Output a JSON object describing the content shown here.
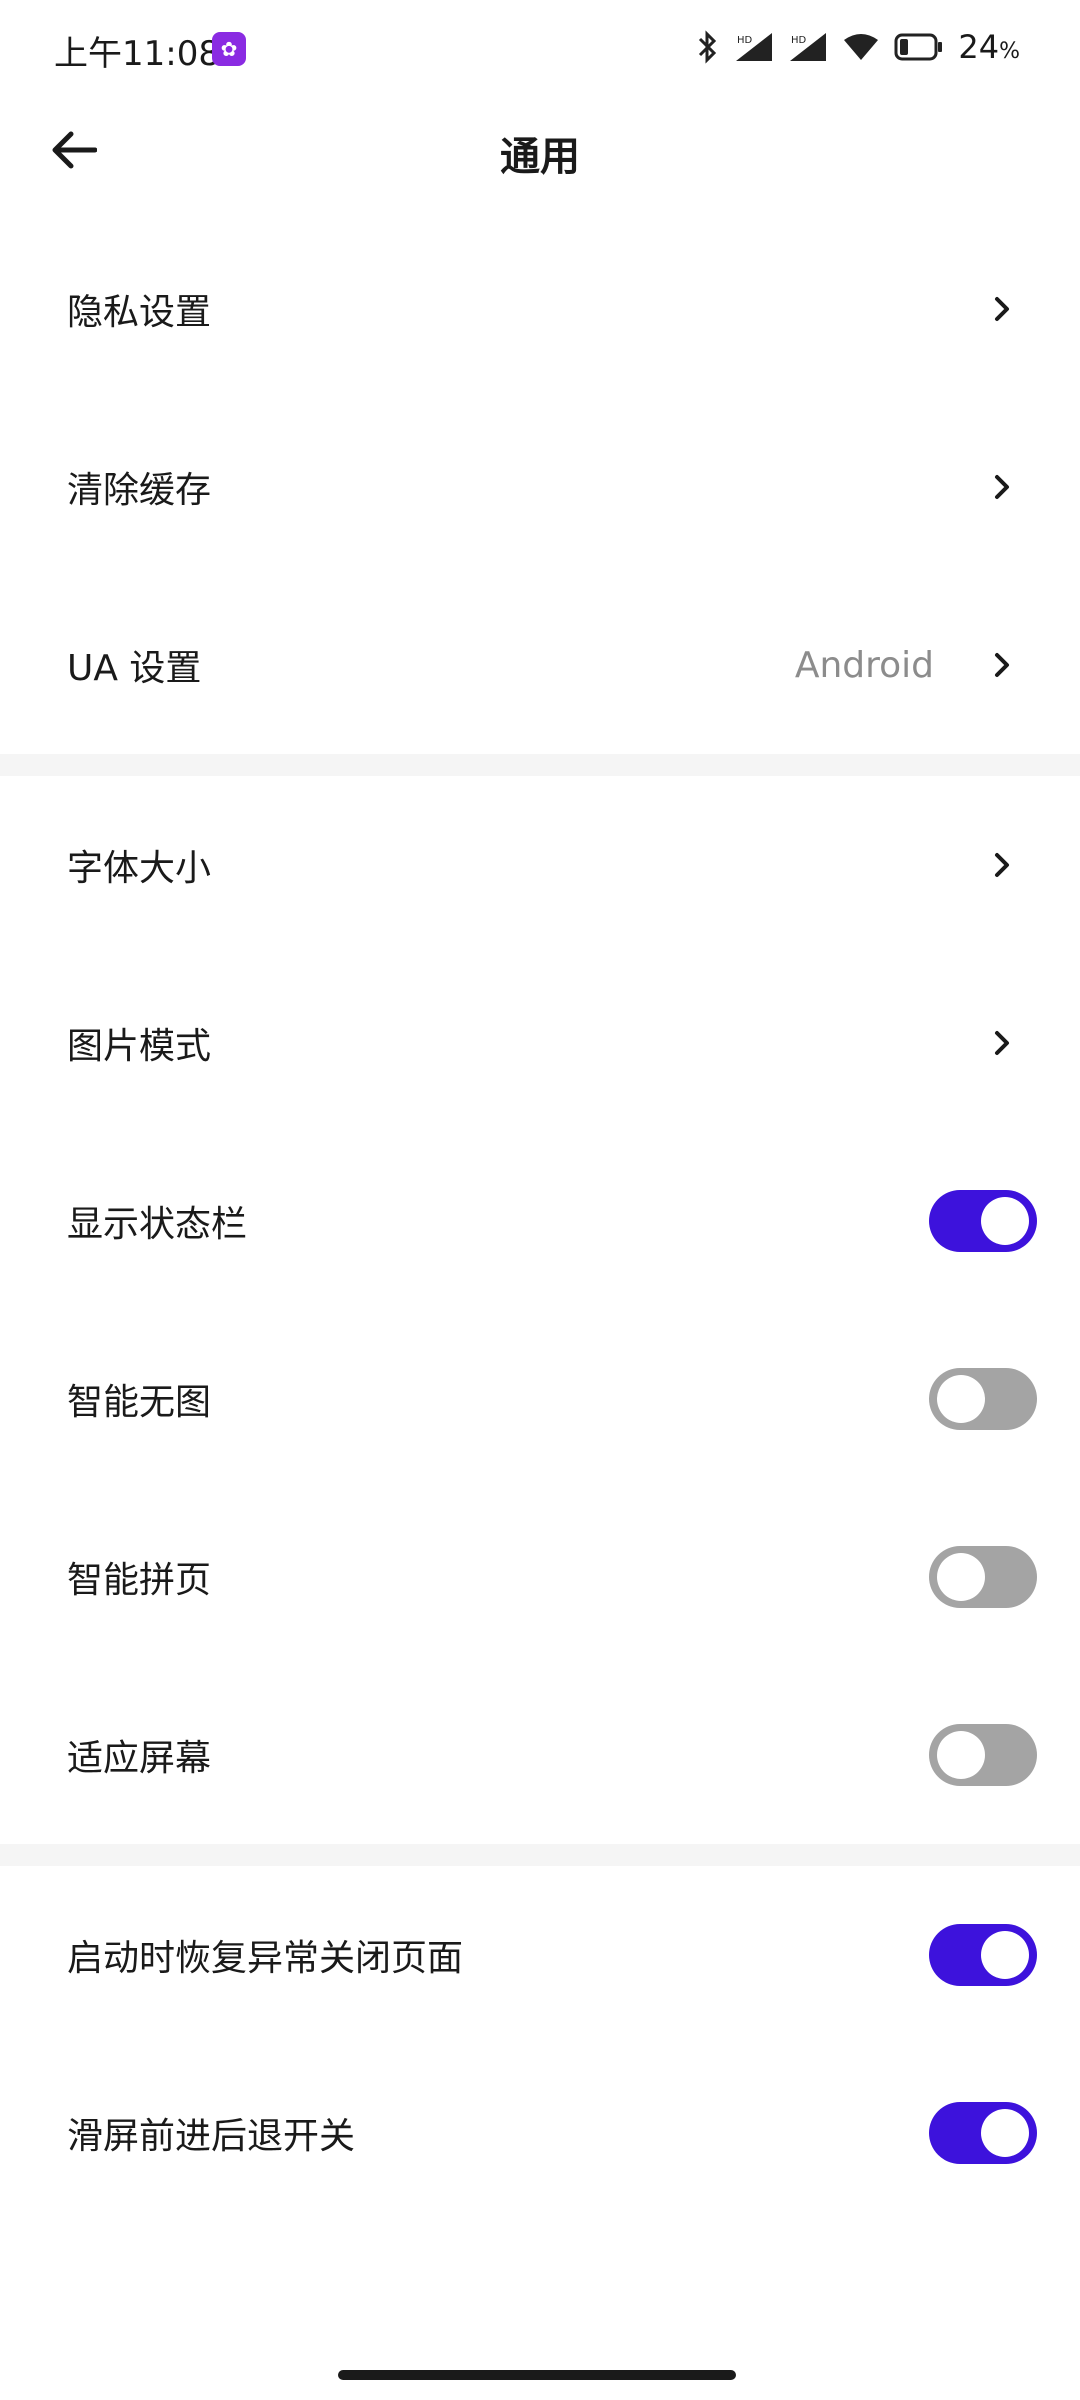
{
  "status_bar": {
    "time": "上午11:08",
    "battery_percent": "24",
    "battery_symbol": "%",
    "battery_level": 0.24,
    "icons": [
      "bluetooth-icon",
      "signal-icon",
      "signal-icon",
      "wifi-icon",
      "battery-icon"
    ]
  },
  "header": {
    "title": "通用",
    "back_icon": "arrow-left-icon"
  },
  "sections": [
    {
      "rows": [
        {
          "label": "隐私设置",
          "type": "nav"
        },
        {
          "label": "清除缓存",
          "type": "nav"
        },
        {
          "label": "UA 设置",
          "type": "nav",
          "value": "Android"
        }
      ]
    },
    {
      "rows": [
        {
          "label": "字体大小",
          "type": "nav"
        },
        {
          "label": "图片模式",
          "type": "nav"
        },
        {
          "label": "显示状态栏",
          "type": "toggle",
          "on": true
        },
        {
          "label": "智能无图",
          "type": "toggle",
          "on": false
        },
        {
          "label": "智能拼页",
          "type": "toggle",
          "on": false
        },
        {
          "label": "适应屏幕",
          "type": "toggle",
          "on": false
        }
      ]
    },
    {
      "rows": [
        {
          "label": "启动时恢复异常关闭页面",
          "type": "toggle",
          "on": true
        },
        {
          "label": "滑屏前进后退开关",
          "type": "toggle",
          "on": true
        }
      ]
    }
  ],
  "colors": {
    "toggle_on": "#3d12dc",
    "toggle_off": "#a4a4a4",
    "app_badge": "#8a2be2"
  }
}
